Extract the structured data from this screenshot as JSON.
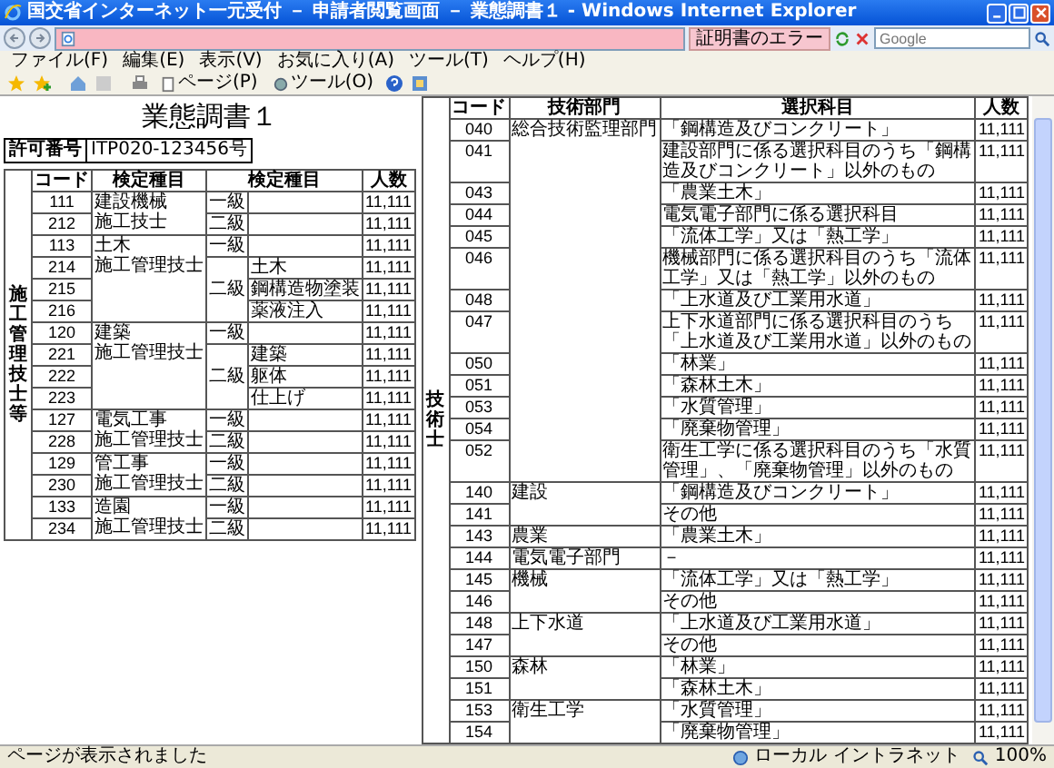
{
  "window": {
    "title": "国交省インターネット一元受付 － 申請者閲覧画面 － 業態調書１ - Windows Internet Explorer"
  },
  "address_bar": {
    "certificate_error": "証明書のエラー"
  },
  "search": {
    "placeholder": "Google"
  },
  "menu": [
    "ファイル(F)",
    "編集(E)",
    "表示(V)",
    "お気に入り(A)",
    "ツール(T)",
    "ヘルプ(H)"
  ],
  "toolbar": [
    "ページ(P)",
    "ツール(O)"
  ],
  "page": {
    "title": "業態調書１",
    "permit": {
      "label": "許可番号",
      "value": "ITP020-123456号"
    }
  },
  "section_1": {
    "label": "施工管理技士等",
    "columns": [
      "コード",
      "検定種目",
      "検定種目",
      "人数"
    ],
    "groups": [
      {
        "name": [
          "建設機械",
          "施工技士"
        ],
        "grades": [
          {
            "grade": "一級",
            "rows": [
              {
                "code": "111",
                "count": "11,111"
              }
            ]
          },
          {
            "grade": "二級",
            "rows": [
              {
                "code": "212",
                "count": "11,111"
              }
            ]
          }
        ]
      },
      {
        "name": [
          "土木",
          "施工管理技士"
        ],
        "grades": [
          {
            "grade": "一級",
            "rows": [
              {
                "code": "113",
                "count": "11,111"
              }
            ]
          },
          {
            "grade": "二級",
            "rows": [
              {
                "code": "214",
                "sub": "土木",
                "count": "11,111"
              },
              {
                "code": "215",
                "sub": "鋼構造物塗装",
                "count": "11,111"
              },
              {
                "code": "216",
                "sub": "薬液注入",
                "count": "11,111"
              }
            ]
          }
        ]
      },
      {
        "name": [
          "建築",
          "施工管理技士"
        ],
        "grades": [
          {
            "grade": "一級",
            "rows": [
              {
                "code": "120",
                "count": "11,111"
              }
            ]
          },
          {
            "grade": "二級",
            "rows": [
              {
                "code": "221",
                "sub": "建築",
                "count": "11,111"
              },
              {
                "code": "222",
                "sub": "躯体",
                "count": "11,111"
              },
              {
                "code": "223",
                "sub": "仕上げ",
                "count": "11,111"
              }
            ]
          }
        ]
      },
      {
        "name": [
          "電気工事",
          "施工管理技士"
        ],
        "grades": [
          {
            "grade": "一級",
            "rows": [
              {
                "code": "127",
                "count": "11,111"
              }
            ]
          },
          {
            "grade": "二級",
            "rows": [
              {
                "code": "228",
                "count": "11,111"
              }
            ]
          }
        ]
      },
      {
        "name": [
          "管工事",
          "施工管理技士"
        ],
        "grades": [
          {
            "grade": "一級",
            "rows": [
              {
                "code": "129",
                "count": "11,111"
              }
            ]
          },
          {
            "grade": "二級",
            "rows": [
              {
                "code": "230",
                "count": "11,111"
              }
            ]
          }
        ]
      },
      {
        "name": [
          "造園",
          "施工管理技士"
        ],
        "grades": [
          {
            "grade": "一級",
            "rows": [
              {
                "code": "133",
                "count": "11,111"
              }
            ]
          },
          {
            "grade": "二級",
            "rows": [
              {
                "code": "234",
                "count": "11,111"
              }
            ]
          }
        ]
      }
    ]
  },
  "section_2": {
    "label": "技術士",
    "columns": [
      "コード",
      "技術部門",
      "選択科目",
      "人数"
    ],
    "groups": [
      {
        "department": "総合技術監理部門",
        "rows": [
          {
            "code": "040",
            "subject": "「鋼構造及びコンクリート」",
            "count": "11,111"
          },
          {
            "code": "041",
            "subject": "建設部門に係る選択科目のうち「鋼構造及びコンクリート」以外のもの",
            "count": "11,111"
          },
          {
            "code": "043",
            "subject": "「農業土木」",
            "count": "11,111"
          },
          {
            "code": "044",
            "subject": "電気電子部門に係る選択科目",
            "count": "11,111"
          },
          {
            "code": "045",
            "subject": "「流体工学」又は「熱工学」",
            "count": "11,111"
          },
          {
            "code": "046",
            "subject": "機械部門に係る選択科目のうち「流体工学」又は「熱工学」以外のもの",
            "count": "11,111"
          },
          {
            "code": "048",
            "subject": "「上水道及び工業用水道」",
            "count": "11,111"
          },
          {
            "code": "047",
            "subject": "上下水道部門に係る選択科目のうち「上水道及び工業用水道」以外のもの",
            "count": "11,111"
          },
          {
            "code": "050",
            "subject": "「林業」",
            "count": "11,111"
          },
          {
            "code": "051",
            "subject": "「森林土木」",
            "count": "11,111"
          },
          {
            "code": "053",
            "subject": "「水質管理」",
            "count": "11,111"
          },
          {
            "code": "054",
            "subject": "「廃棄物管理」",
            "count": "11,111"
          },
          {
            "code": "052",
            "subject": "衛生工学に係る選択科目のうち「水質管理」、「廃棄物管理」以外のもの",
            "count": "11,111"
          }
        ]
      },
      {
        "department": "建設",
        "rows": [
          {
            "code": "140",
            "subject": "「鋼構造及びコンクリート」",
            "count": "11,111"
          },
          {
            "code": "141",
            "subject": "その他",
            "count": "11,111"
          }
        ]
      },
      {
        "department": "農業",
        "rows": [
          {
            "code": "143",
            "subject": "「農業土木」",
            "count": "11,111"
          }
        ]
      },
      {
        "department": "電気電子部門",
        "rows": [
          {
            "code": "144",
            "subject": "－",
            "count": "11,111"
          }
        ]
      },
      {
        "department": "機械",
        "rows": [
          {
            "code": "145",
            "subject": "「流体工学」又は「熱工学」",
            "count": "11,111"
          },
          {
            "code": "146",
            "subject": "その他",
            "count": "11,111"
          }
        ]
      },
      {
        "department": "上下水道",
        "rows": [
          {
            "code": "148",
            "subject": "「上水道及び工業用水道」",
            "count": "11,111"
          },
          {
            "code": "147",
            "subject": "その他",
            "count": "11,111"
          }
        ]
      },
      {
        "department": "森林",
        "rows": [
          {
            "code": "150",
            "subject": "「林業」",
            "count": "11,111"
          },
          {
            "code": "151",
            "subject": "「森林土木」",
            "count": "11,111"
          }
        ]
      },
      {
        "department": "衛生工学",
        "rows": [
          {
            "code": "153",
            "subject": "「水質管理」",
            "count": "11,111"
          },
          {
            "code": "154",
            "subject": "「廃棄物管理」",
            "count": "11,111"
          }
        ]
      }
    ]
  },
  "status_bar": {
    "message": "ページが表示されました",
    "zone": "ローカル イントラネット",
    "zoom": "100%"
  }
}
